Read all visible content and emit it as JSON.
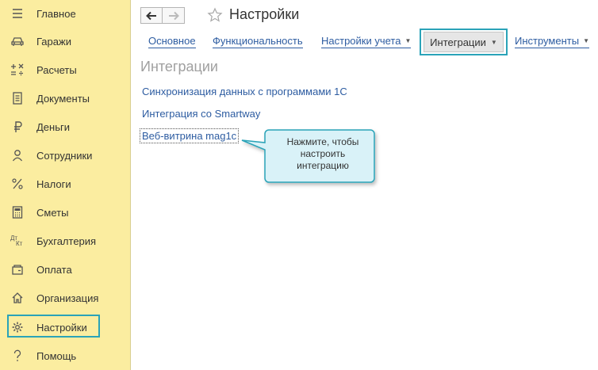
{
  "sidebar": {
    "items": [
      {
        "label": "Главное",
        "icon": "hamburger-icon"
      },
      {
        "label": "Гаражи",
        "icon": "car-icon"
      },
      {
        "label": "Расчеты",
        "icon": "calculations-icon"
      },
      {
        "label": "Документы",
        "icon": "document-icon"
      },
      {
        "label": "Деньги",
        "icon": "ruble-icon"
      },
      {
        "label": "Сотрудники",
        "icon": "person-icon"
      },
      {
        "label": "Налоги",
        "icon": "percent-icon"
      },
      {
        "label": "Сметы",
        "icon": "calculator-icon"
      },
      {
        "label": "Бухгалтерия",
        "icon": "accounting-icon"
      },
      {
        "label": "Оплата",
        "icon": "payment-icon"
      },
      {
        "label": "Организация",
        "icon": "home-icon"
      },
      {
        "label": "Настройки",
        "icon": "gear-icon"
      },
      {
        "label": "Помощь",
        "icon": "question-icon"
      }
    ],
    "active_index": 11,
    "accounting_icon_text": {
      "top": "Дт",
      "bottom": "Кт"
    }
  },
  "header": {
    "title": "Настройки",
    "back_icon": "arrow-left-icon",
    "forward_icon": "arrow-right-icon",
    "favorite_icon": "star-icon"
  },
  "tabs": [
    {
      "label": "Основное",
      "dropdown": false
    },
    {
      "label": "Функциональность",
      "dropdown": false
    },
    {
      "label": "Настройки учета",
      "dropdown": true
    },
    {
      "label": "Интеграции",
      "dropdown": true,
      "active": true
    },
    {
      "label": "Инструменты",
      "dropdown": true
    }
  ],
  "tab_caret": "▼",
  "section": {
    "title": "Интеграции"
  },
  "links": [
    {
      "label": "Синхронизация данных с программами 1С"
    },
    {
      "label": "Интеграция со Smartway"
    },
    {
      "label": "Веб-витрина mag1c"
    }
  ],
  "tooltip": {
    "lines": [
      "Нажмите, чтобы",
      "настроить",
      "интеграцию"
    ]
  },
  "colors": {
    "sidebar_bg": "#fbeda0",
    "highlight": "#2aa3b8",
    "link": "#2d5ca1",
    "tooltip_bg": "#d9f2f8"
  }
}
